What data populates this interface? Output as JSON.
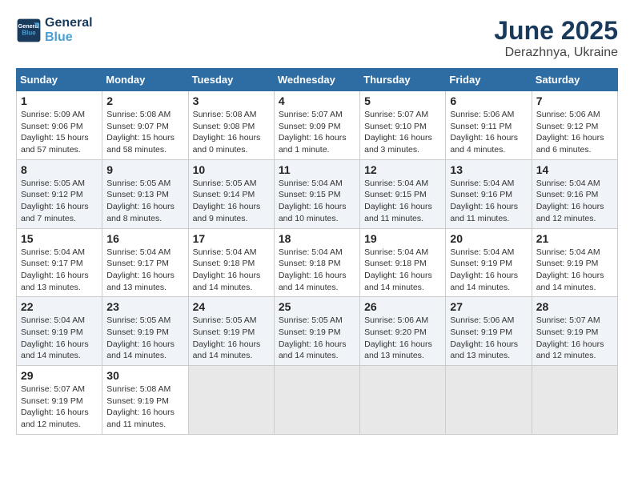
{
  "logo": {
    "line1": "General",
    "line2": "Blue"
  },
  "title": "June 2025",
  "location": "Derazhnya, Ukraine",
  "days_header": [
    "Sunday",
    "Monday",
    "Tuesday",
    "Wednesday",
    "Thursday",
    "Friday",
    "Saturday"
  ],
  "weeks": [
    [
      {
        "day": "1",
        "info": "Sunrise: 5:09 AM\nSunset: 9:06 PM\nDaylight: 15 hours\nand 57 minutes."
      },
      {
        "day": "2",
        "info": "Sunrise: 5:08 AM\nSunset: 9:07 PM\nDaylight: 15 hours\nand 58 minutes."
      },
      {
        "day": "3",
        "info": "Sunrise: 5:08 AM\nSunset: 9:08 PM\nDaylight: 16 hours\nand 0 minutes."
      },
      {
        "day": "4",
        "info": "Sunrise: 5:07 AM\nSunset: 9:09 PM\nDaylight: 16 hours\nand 1 minute."
      },
      {
        "day": "5",
        "info": "Sunrise: 5:07 AM\nSunset: 9:10 PM\nDaylight: 16 hours\nand 3 minutes."
      },
      {
        "day": "6",
        "info": "Sunrise: 5:06 AM\nSunset: 9:11 PM\nDaylight: 16 hours\nand 4 minutes."
      },
      {
        "day": "7",
        "info": "Sunrise: 5:06 AM\nSunset: 9:12 PM\nDaylight: 16 hours\nand 6 minutes."
      }
    ],
    [
      {
        "day": "8",
        "info": "Sunrise: 5:05 AM\nSunset: 9:12 PM\nDaylight: 16 hours\nand 7 minutes."
      },
      {
        "day": "9",
        "info": "Sunrise: 5:05 AM\nSunset: 9:13 PM\nDaylight: 16 hours\nand 8 minutes."
      },
      {
        "day": "10",
        "info": "Sunrise: 5:05 AM\nSunset: 9:14 PM\nDaylight: 16 hours\nand 9 minutes."
      },
      {
        "day": "11",
        "info": "Sunrise: 5:04 AM\nSunset: 9:15 PM\nDaylight: 16 hours\nand 10 minutes."
      },
      {
        "day": "12",
        "info": "Sunrise: 5:04 AM\nSunset: 9:15 PM\nDaylight: 16 hours\nand 11 minutes."
      },
      {
        "day": "13",
        "info": "Sunrise: 5:04 AM\nSunset: 9:16 PM\nDaylight: 16 hours\nand 11 minutes."
      },
      {
        "day": "14",
        "info": "Sunrise: 5:04 AM\nSunset: 9:16 PM\nDaylight: 16 hours\nand 12 minutes."
      }
    ],
    [
      {
        "day": "15",
        "info": "Sunrise: 5:04 AM\nSunset: 9:17 PM\nDaylight: 16 hours\nand 13 minutes."
      },
      {
        "day": "16",
        "info": "Sunrise: 5:04 AM\nSunset: 9:17 PM\nDaylight: 16 hours\nand 13 minutes."
      },
      {
        "day": "17",
        "info": "Sunrise: 5:04 AM\nSunset: 9:18 PM\nDaylight: 16 hours\nand 14 minutes."
      },
      {
        "day": "18",
        "info": "Sunrise: 5:04 AM\nSunset: 9:18 PM\nDaylight: 16 hours\nand 14 minutes."
      },
      {
        "day": "19",
        "info": "Sunrise: 5:04 AM\nSunset: 9:18 PM\nDaylight: 16 hours\nand 14 minutes."
      },
      {
        "day": "20",
        "info": "Sunrise: 5:04 AM\nSunset: 9:19 PM\nDaylight: 16 hours\nand 14 minutes."
      },
      {
        "day": "21",
        "info": "Sunrise: 5:04 AM\nSunset: 9:19 PM\nDaylight: 16 hours\nand 14 minutes."
      }
    ],
    [
      {
        "day": "22",
        "info": "Sunrise: 5:04 AM\nSunset: 9:19 PM\nDaylight: 16 hours\nand 14 minutes."
      },
      {
        "day": "23",
        "info": "Sunrise: 5:05 AM\nSunset: 9:19 PM\nDaylight: 16 hours\nand 14 minutes."
      },
      {
        "day": "24",
        "info": "Sunrise: 5:05 AM\nSunset: 9:19 PM\nDaylight: 16 hours\nand 14 minutes."
      },
      {
        "day": "25",
        "info": "Sunrise: 5:05 AM\nSunset: 9:19 PM\nDaylight: 16 hours\nand 14 minutes."
      },
      {
        "day": "26",
        "info": "Sunrise: 5:06 AM\nSunset: 9:20 PM\nDaylight: 16 hours\nand 13 minutes."
      },
      {
        "day": "27",
        "info": "Sunrise: 5:06 AM\nSunset: 9:19 PM\nDaylight: 16 hours\nand 13 minutes."
      },
      {
        "day": "28",
        "info": "Sunrise: 5:07 AM\nSunset: 9:19 PM\nDaylight: 16 hours\nand 12 minutes."
      }
    ],
    [
      {
        "day": "29",
        "info": "Sunrise: 5:07 AM\nSunset: 9:19 PM\nDaylight: 16 hours\nand 12 minutes."
      },
      {
        "day": "30",
        "info": "Sunrise: 5:08 AM\nSunset: 9:19 PM\nDaylight: 16 hours\nand 11 minutes."
      },
      {
        "day": "",
        "info": ""
      },
      {
        "day": "",
        "info": ""
      },
      {
        "day": "",
        "info": ""
      },
      {
        "day": "",
        "info": ""
      },
      {
        "day": "",
        "info": ""
      }
    ]
  ]
}
